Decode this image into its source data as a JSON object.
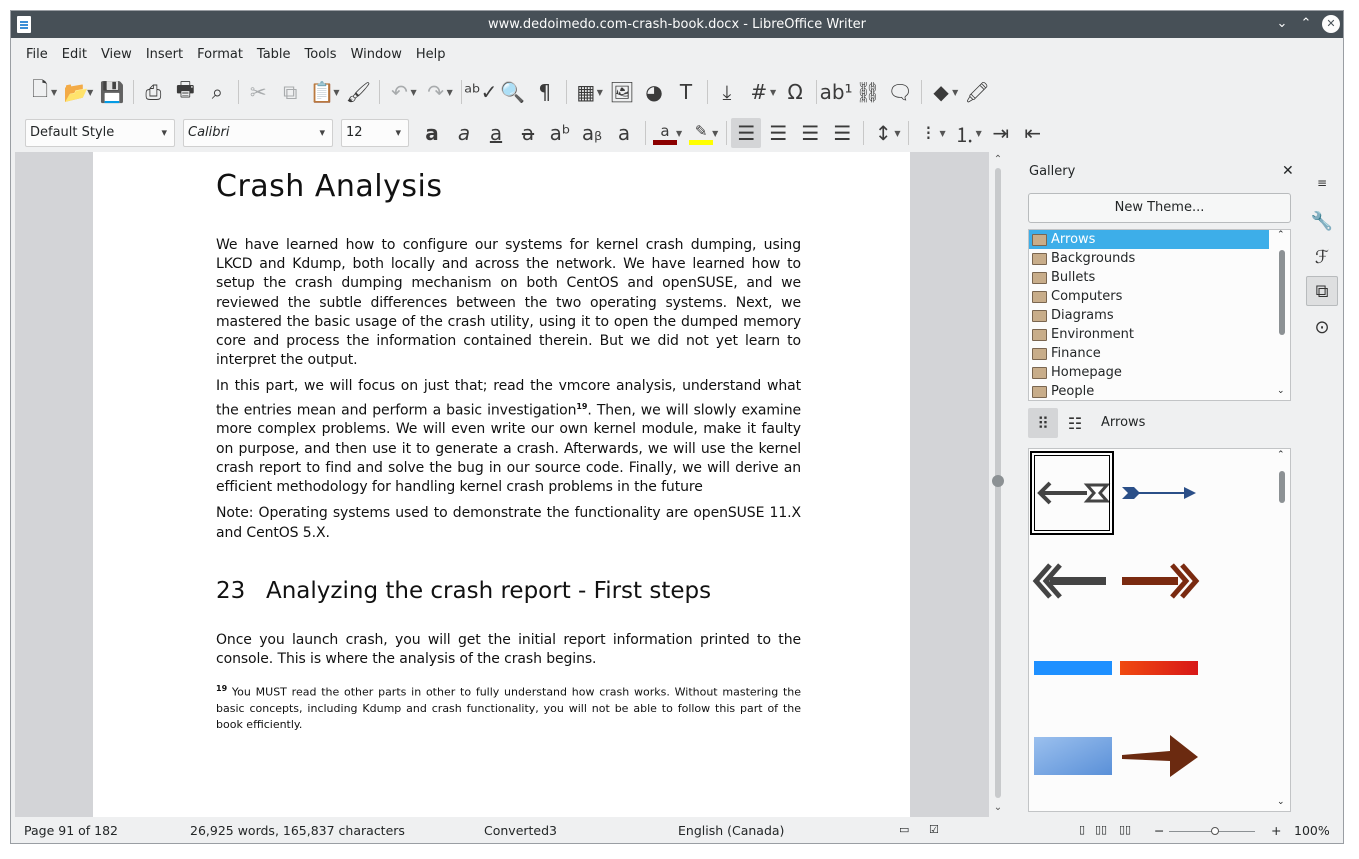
{
  "window": {
    "title": "www.dedoimedo.com-crash-book.docx - LibreOffice Writer"
  },
  "menu": [
    "File",
    "Edit",
    "View",
    "Insert",
    "Format",
    "Table",
    "Tools",
    "Window",
    "Help"
  ],
  "toolbar2": {
    "paragraph_style": "Default Style",
    "font_name": "Calibri",
    "font_size": "12"
  },
  "document": {
    "heading1": "Crash Analysis",
    "paragraphs": [
      "We have learned how to configure our systems for kernel crash dumping, using LKCD and Kdump, both locally and across the network.  We have learned how to setup the crash dumping mechanism on both CentOS and openSUSE, and we reviewed the subtle differences between the two operating systems.  Next, we mastered the basic usage of the crash utility, using it to open the dumped memory core and process the information contained therein. But we did not yet learn to interpret the output.",
      "Then, we will slowly examine more complex problems. We will even write our own kernel module, make it faulty on purpose, and then use it to generate a crash. Afterwards, we will use the kernel crash report to find and solve the bug in our source code. Finally, we will derive an efficient methodology for handling kernel crash problems in the future",
      "Note: Operating systems used to demonstrate the functionality are openSUSE 11.X and CentOS 5.X."
    ],
    "para2_intro": "In this part, we will focus on just that; read the vmcore analysis, understand what the entries mean and perform a basic investigation",
    "footnote_ref": "19",
    "heading2_number": "23",
    "heading2_text": "Analyzing the crash report - First steps",
    "para4": "Once you launch crash, you will get the initial report information printed to the console. This is where the analysis of the crash begins.",
    "footnote_text": "You MUST read the other parts in other to fully understand how crash works. Without mastering the basic concepts, including Kdump and crash functionality, you will not be able to follow this part of the book efficiently."
  },
  "gallery": {
    "title": "Gallery",
    "new_theme_label": "New Theme...",
    "themes": [
      "Arrows",
      "Backgrounds",
      "Bullets",
      "Computers",
      "Diagrams",
      "Environment",
      "Finance",
      "Homepage",
      "People"
    ],
    "selected_theme": "Arrows",
    "current_label": "Arrows"
  },
  "status": {
    "page": "Page 91 of 182",
    "words": "26,925 words, 165,837 characters",
    "style": "Converted3",
    "language": "English (Canada)",
    "zoom": "100%"
  },
  "colors": {
    "font_color": "#8b0000",
    "highlight": "#ffff00",
    "selection": "#3daee9",
    "titlebar": "#475057"
  }
}
